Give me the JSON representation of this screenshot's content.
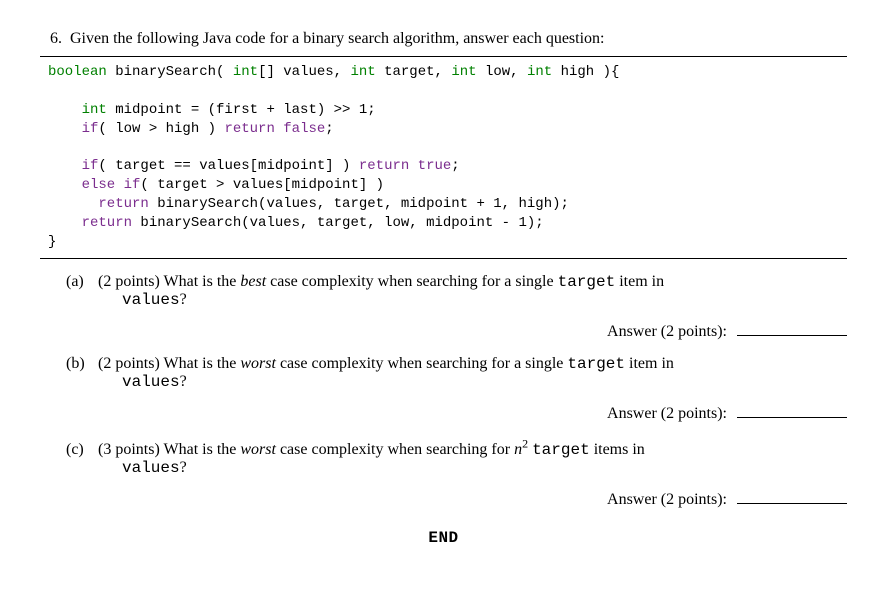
{
  "question": {
    "number": "6.",
    "prompt": "Given the following Java code for a binary search algorithm, answer each question:"
  },
  "code": {
    "l1a": "boolean",
    "l1b": " binarySearch( ",
    "l1c": "int",
    "l1d": "[] values, ",
    "l1e": "int",
    "l1f": " target, ",
    "l1g": "int",
    "l1h": " low, ",
    "l1i": "int",
    "l1j": " high ){",
    "l2a": "    int",
    "l2b": " midpoint = (first + last) >> 1;",
    "l3a": "    if",
    "l3b": "( low > high ) ",
    "l3c": "return false",
    "l3d": ";",
    "l4a": "    if",
    "l4b": "( target == values[midpoint] ) ",
    "l4c": "return true",
    "l4d": ";",
    "l5a": "    else if",
    "l5b": "( target > values[midpoint] )",
    "l6a": "      return",
    "l6b": " binarySearch(values, target, midpoint + 1, high);",
    "l7a": "    return",
    "l7b": " binarySearch(values, target, low, midpoint - 1);",
    "l8": "}"
  },
  "subparts": {
    "a": {
      "label": "(a)",
      "points": "(2 points)",
      "t1": " What is the ",
      "best": "best",
      "t2": " case complexity when searching for a single ",
      "target": "target",
      "t3": " item in",
      "cont_pre": "",
      "values": "values",
      "qmark": "?"
    },
    "b": {
      "label": "(b)",
      "points": "(2 points)",
      "t1": " What is the ",
      "worst": "worst",
      "t2": " case complexity when searching for a single ",
      "target": "target",
      "t3": " item in",
      "values": "values",
      "qmark": "?"
    },
    "c": {
      "label": "(c)",
      "points": "(3 points)",
      "t1": " What is the ",
      "worst": "worst",
      "t2": " case complexity when searching for ",
      "nexpr_n": "n",
      "nexpr_sup": "2",
      "space": " ",
      "target": "target",
      "t3": " items in",
      "values": "values",
      "qmark": "?"
    }
  },
  "answer": {
    "a": "Answer (2 points):",
    "b": "Answer (2 points):",
    "c": "Answer (2 points):"
  },
  "end": "END"
}
